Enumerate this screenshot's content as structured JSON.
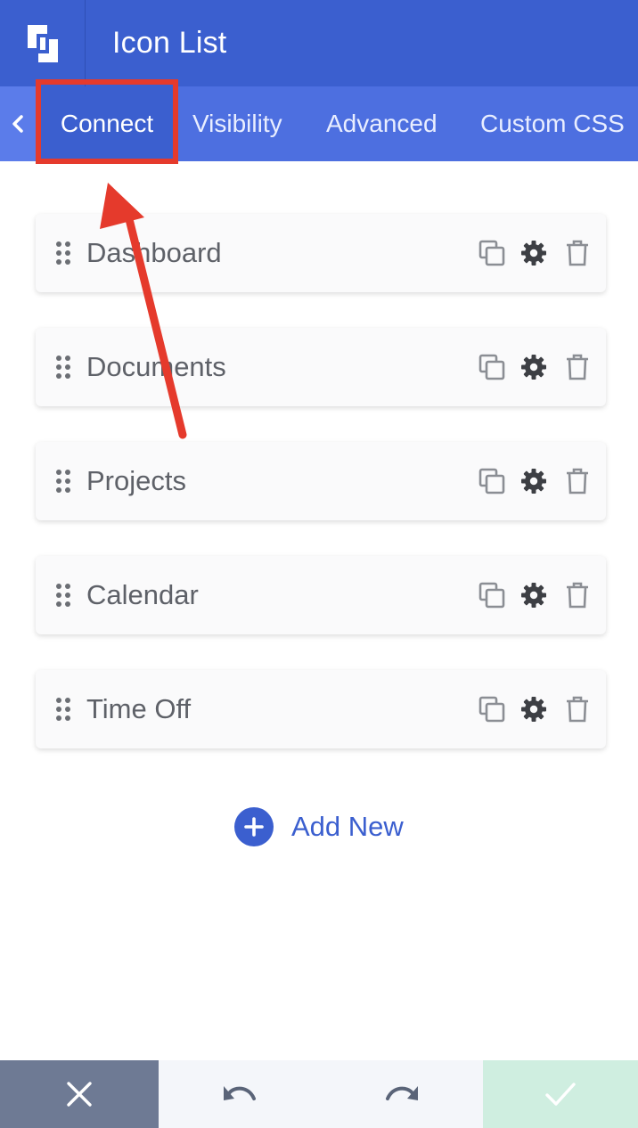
{
  "header": {
    "title": "Icon List",
    "logo_icon": "builder-logo-icon"
  },
  "tabs": [
    {
      "label": "Connect",
      "active": true
    },
    {
      "label": "Visibility",
      "active": false
    },
    {
      "label": "Advanced",
      "active": false
    },
    {
      "label": "Custom CSS",
      "active": false
    }
  ],
  "items": [
    {
      "label": "Dashboard"
    },
    {
      "label": "Documents"
    },
    {
      "label": "Projects"
    },
    {
      "label": "Calendar"
    },
    {
      "label": "Time Off"
    }
  ],
  "add_new": {
    "label": "Add New"
  },
  "footer": {
    "cancel_icon": "close-icon",
    "undo_icon": "undo-icon",
    "redo_icon": "redo-icon",
    "save_icon": "check-icon"
  },
  "colors": {
    "header_bg": "#3b5fcf",
    "tabs_bg": "#4d6fe0",
    "annotation_red": "#e53a2c",
    "cancel_bg": "#6e7a94",
    "save_bg": "#cfeee0"
  }
}
